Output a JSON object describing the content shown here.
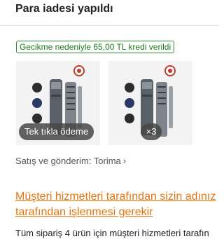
{
  "header": {
    "title": "Para iadesi yapıldı"
  },
  "credit_badge": {
    "text": "Gecikme nedeniyle 65,00 TL kredi verildi",
    "color": "#1a7f1a"
  },
  "products": {
    "one_click_pay_label": "Tek tıkla ödeme",
    "extra_count_label": "×3",
    "items": [
      {
        "icon": "screwdriver-set-image"
      },
      {
        "icon": "screwdriver-set-image"
      }
    ]
  },
  "seller": {
    "label": "Satış ve gönderim: Torima",
    "chevron_icon": "chevron-right-icon"
  },
  "support_notice": {
    "line1": "Müşteri hizmetleri tarafından sizin adınız",
    "line2": "tarafından işlenmesi gerekir",
    "color": "#e8740c"
  },
  "body": {
    "text": "Tüm sipariş 4 ürün için müşteri hizmetleri tarafın"
  }
}
